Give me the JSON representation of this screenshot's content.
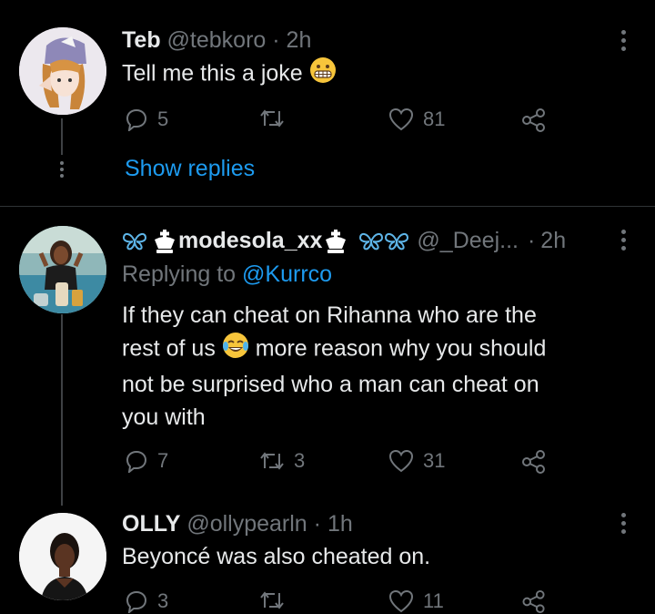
{
  "tweets": [
    {
      "name": "Teb",
      "handle": "@tebkoro",
      "sep": "·",
      "time": "2h",
      "text": "Tell me this a joke",
      "replies": "5",
      "retweets": "",
      "likes": "81",
      "avatar_icon": "anime-girl-avatar"
    },
    {
      "name": "modesola_xx",
      "handle": "@_Deej...",
      "sep": "·",
      "time": "2h",
      "replying_label": "Replying to",
      "replying_to": "@Kurrco",
      "text_line1": "If they can cheat on Rihanna who are the",
      "text_line2a": "rest of us",
      "text_line2b": "more reason why you should",
      "text_line3": "not be surprised who a man can cheat on",
      "text_line4": "you with",
      "replies": "7",
      "retweets": "3",
      "likes": "31",
      "avatar_icon": "woman-photo-avatar"
    },
    {
      "name": "OLLY",
      "handle": "@ollypearln",
      "sep": "·",
      "time": "1h",
      "text": "Beyoncé was also cheated on.",
      "replies": "3",
      "retweets": "",
      "likes": "11",
      "avatar_icon": "woman-portrait-avatar"
    }
  ],
  "show_replies": "Show replies",
  "colors": {
    "background": "#000000",
    "text": "#e7e9ea",
    "muted": "#71767b",
    "link": "#1d9bf0",
    "divider": "#2f3336"
  }
}
